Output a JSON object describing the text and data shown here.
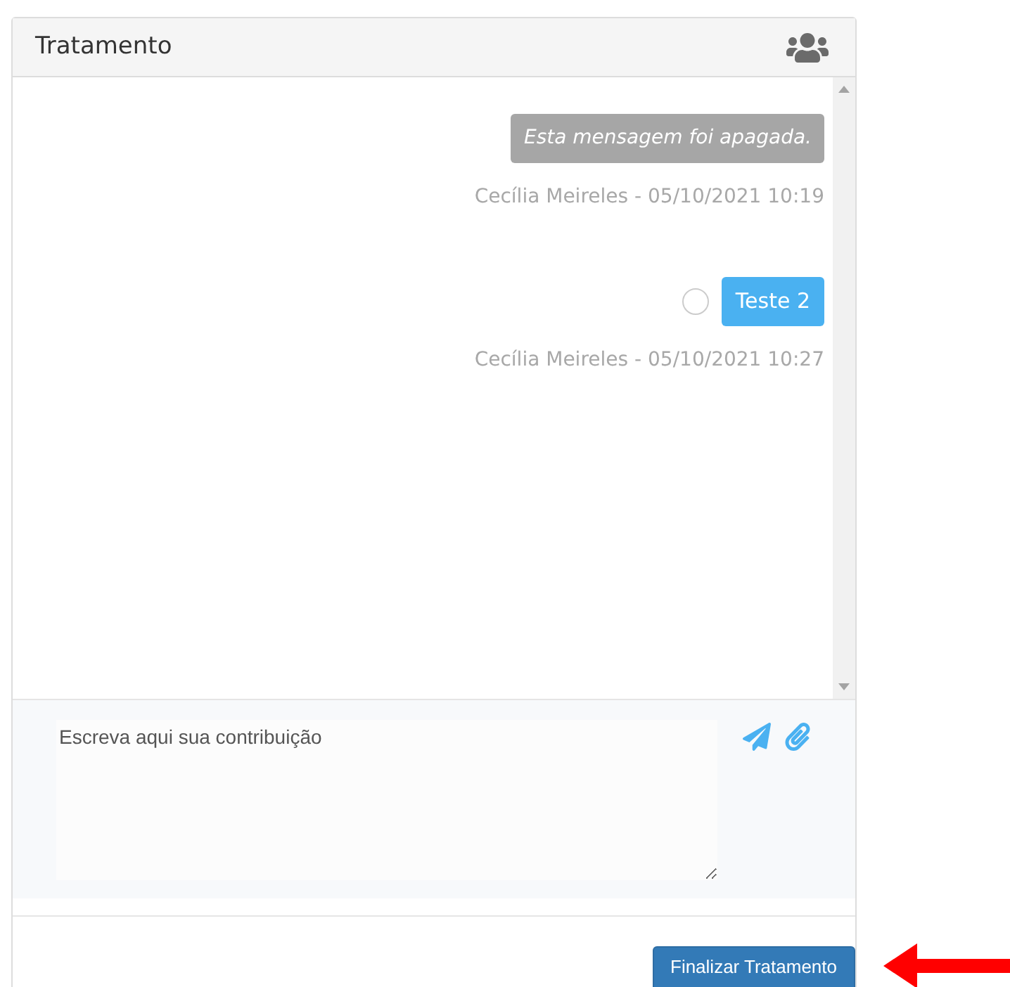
{
  "panel": {
    "title": "Tratamento"
  },
  "messages": [
    {
      "kind": "deleted",
      "text": "Esta mensagem foi apagada.",
      "meta": "Cecília Meireles - 05/10/2021 10:19"
    },
    {
      "kind": "text",
      "text": "Teste 2",
      "meta": "Cecília Meireles - 05/10/2021 10:27"
    }
  ],
  "composer": {
    "placeholder": "Escreva aqui sua contribuição"
  },
  "buttons": [
    "Finalizar Tratamento"
  ]
}
